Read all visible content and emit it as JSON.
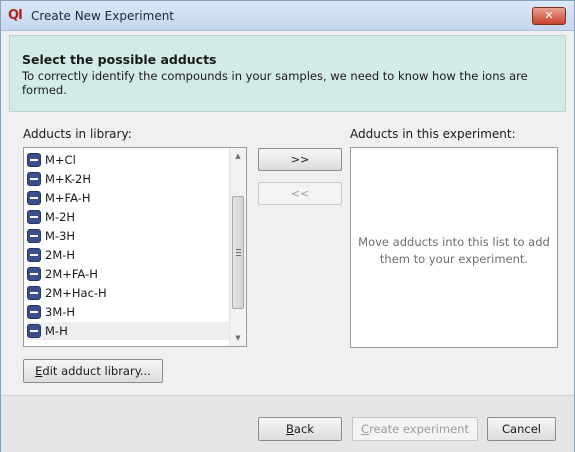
{
  "window": {
    "title": "Create New Experiment",
    "app_icon_glyph": "QI",
    "close_glyph": "✕"
  },
  "header": {
    "title": "Select the possible adducts",
    "description": "To correctly identify the compounds in your samples, we need to know how the ions are formed."
  },
  "library": {
    "label": "Adducts in library:",
    "items": [
      "M+Cl",
      "M+K-2H",
      "M+FA-H",
      "M-2H",
      "M-3H",
      "2M-H",
      "2M+FA-H",
      "2M+Hac-H",
      "3M-H",
      "M-H"
    ]
  },
  "transfer": {
    "add_label": ">>",
    "remove_label": "<<"
  },
  "experiment": {
    "label": "Adducts in this experiment:",
    "placeholder": "Move adducts into this list to add them to your experiment."
  },
  "buttons": {
    "edit_prefix": "E",
    "edit_rest": "dit adduct library...",
    "back_prefix": "B",
    "back_rest": "ack",
    "create_prefix": "C",
    "create_rest": "reate experiment",
    "cancel": "Cancel"
  },
  "icons": {
    "adduct_item": "minus-icon",
    "scroll_up": "scroll-up-arrow-icon",
    "scroll_down": "scroll-down-arrow-icon"
  },
  "colors": {
    "header_bg": "#d3ebe7",
    "item_icon": "#3b4f8f",
    "close_button": "#c7432b"
  }
}
